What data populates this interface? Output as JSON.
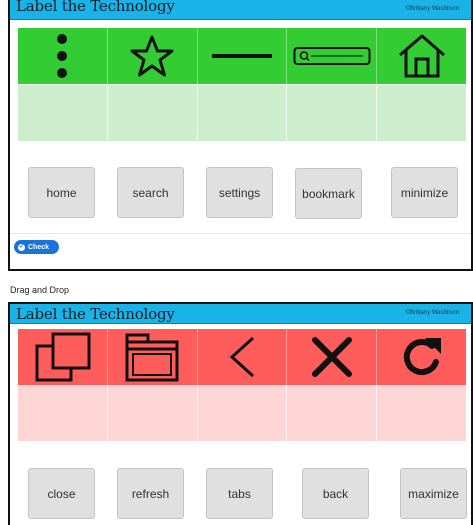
{
  "activity1": {
    "title": "Label the Technology",
    "credit": "©Brittany Washburn",
    "icons": [
      "kebab-menu-icon",
      "star-icon",
      "minus-icon",
      "search-bar-icon",
      "home-icon"
    ],
    "chips": [
      "home",
      "search",
      "settings",
      "bookmark",
      "minimize"
    ],
    "check_label": "Check",
    "colors": {
      "icon_row": "#33cc33",
      "drop_row": "#cdeecd"
    }
  },
  "caption": "Drag and Drop",
  "activity2": {
    "title": "Label the Technology",
    "credit": "©Brittany Washburn",
    "icons": [
      "duplicate-windows-icon",
      "browser-tabs-icon",
      "chevron-left-icon",
      "close-x-icon",
      "refresh-arrow-icon"
    ],
    "chips": [
      "close",
      "refresh",
      "tabs",
      "back",
      "maximize"
    ],
    "colors": {
      "icon_row": "#ff5c5c",
      "drop_row": "#ffd6d6"
    }
  },
  "colors": {
    "banner": "#1ab3e8",
    "check_button": "#1a73d9"
  }
}
